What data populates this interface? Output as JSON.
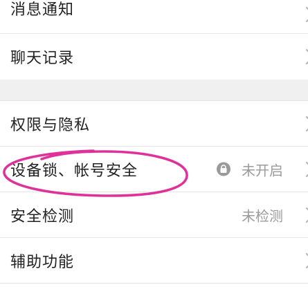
{
  "settings": {
    "group1": {
      "notifications": {
        "label": "消息通知",
        "icon": "chevron-right-icon"
      },
      "chat_history": {
        "label": "聊天记录",
        "icon": "chevron-right-icon"
      }
    },
    "group2": {
      "permissions_privacy": {
        "label": "权限与隐私",
        "icon": "chevron-right-icon"
      },
      "device_lock_account": {
        "label": "设备锁、帐号安全",
        "status": "未开启",
        "status_icon": "lock-icon",
        "icon": "chevron-right-icon"
      },
      "security_check": {
        "label": "安全检测",
        "status": "未检测"
      },
      "accessibility": {
        "label": "辅助功能",
        "icon": "chevron-right-icon"
      }
    }
  },
  "colors": {
    "background": "#ffffff",
    "section_gap": "#f0f0f0",
    "divider": "#e6e6e6",
    "text_primary": "#222222",
    "text_secondary": "#9a9a9a",
    "chevron": "#b4b4b4",
    "annotation": "#e0309a"
  },
  "annotation": {
    "type": "hand-drawn ellipse",
    "target": "device_lock_account"
  }
}
